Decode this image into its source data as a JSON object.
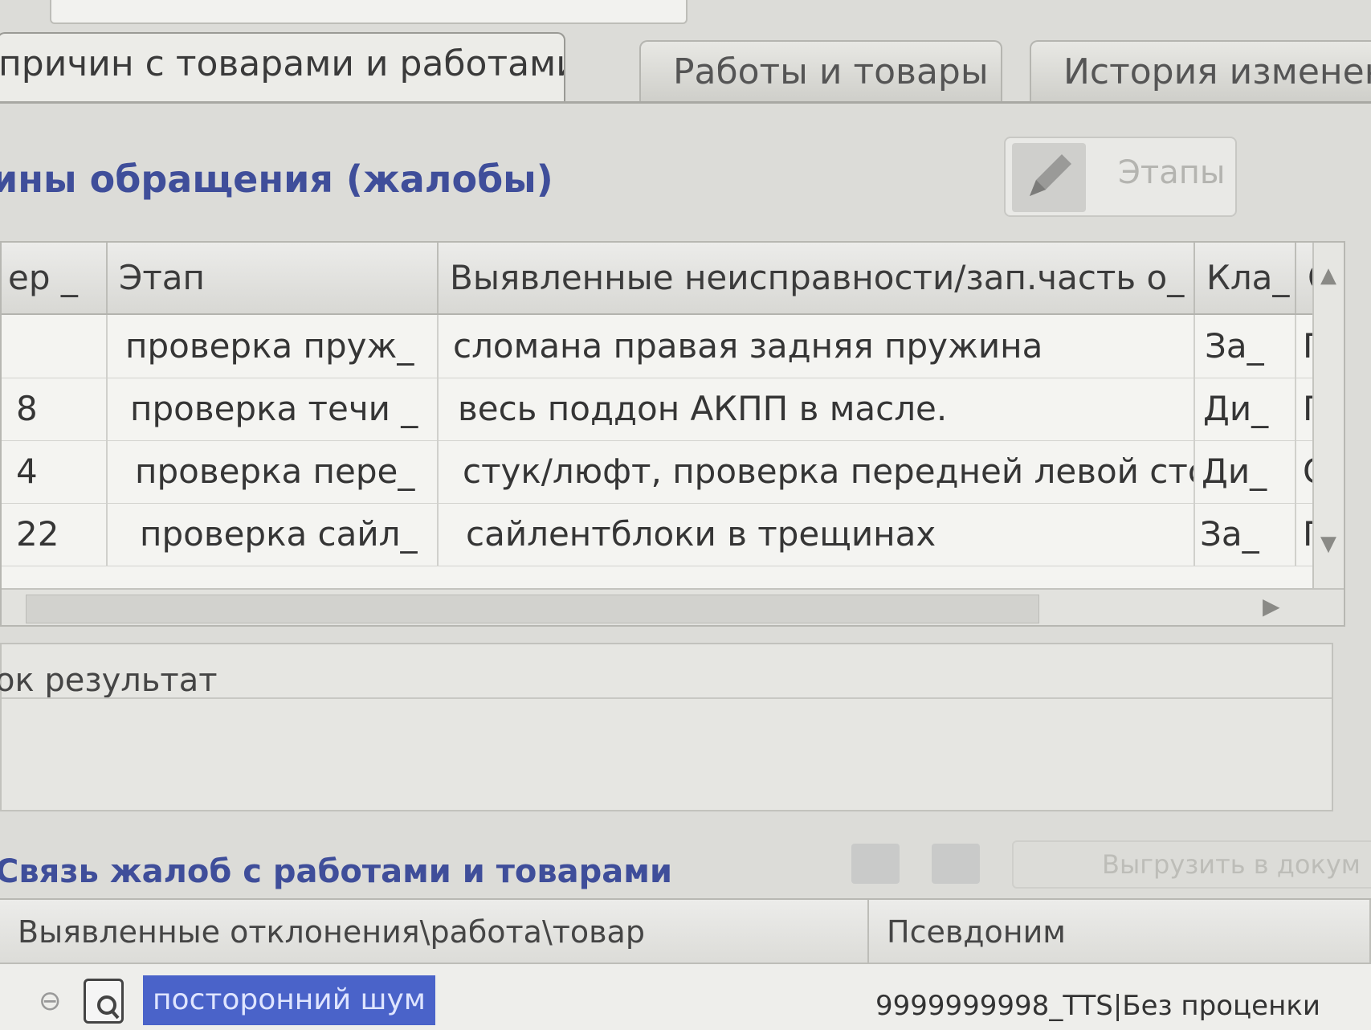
{
  "tabs": [
    {
      "label": "причин с товарами и работами",
      "active": true
    },
    {
      "label": "Работы и товары",
      "active": false
    },
    {
      "label": "История изменений",
      "active": false
    }
  ],
  "complaints": {
    "title": "ины обращения (жалобы)",
    "stages_button": "Этапы",
    "columns": [
      "ер _",
      "Этап",
      "Выявленные неисправности/зап.часть о_",
      "Кла_",
      "С"
    ],
    "rows": [
      {
        "num": "",
        "stage": "проверка пруж_",
        "defect": "сломана правая задняя пружина",
        "cls": "За_",
        "s": "П"
      },
      {
        "num": "8",
        "stage": "проверка течи _",
        "defect": "весь поддон АКПП в масле.",
        "cls": "Ди_",
        "s": "П"
      },
      {
        "num": "4",
        "stage": "проверка пере_",
        "defect": "стук/люфт, проверка передней левой сто_",
        "cls": "Ди_",
        "s": "С"
      },
      {
        "num": "22",
        "stage": "проверка сайл_",
        "defect": "сайлентблоки в трещинах",
        "cls": "За_",
        "s": "П"
      }
    ]
  },
  "result": {
    "label": "ок результат"
  },
  "links": {
    "title": "Связь жалоб с работами и товарами",
    "export_button": "Выгрузить в докум",
    "columns": [
      "Выявленные отклонения\\работа\\товар",
      "Псевдоним"
    ],
    "selected_item": "посторонний шум",
    "alias_value": "9999999998_TTS|Без проценки"
  },
  "colors": {
    "accent_title": "#3f4e9a",
    "selection": "#4a63c9"
  }
}
